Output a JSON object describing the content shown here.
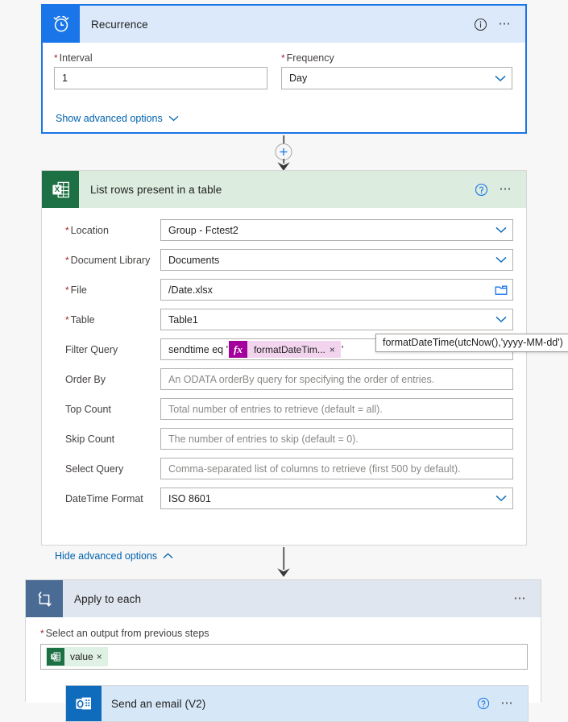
{
  "colors": {
    "recurrence_icon_bg": "#1a76e8",
    "recurrence_header_bg": "#dbe9fb",
    "recurrence_border": "#1a76e8",
    "excel_icon_bg": "#1d7044",
    "excel_header_bg": "#dcecdf",
    "loop_icon_bg": "#4a6c94",
    "loop_header_bg": "#dfe6ef",
    "outlook_icon_bg": "#0f6cbd",
    "outlook_header_bg": "#d6e7f7",
    "link_blue": "#0062ad",
    "required_red": "#a4262c",
    "token_magenta": "#a4009b"
  },
  "cards": {
    "recurrence": {
      "title": "Recurrence",
      "icon": "alarm-clock-icon",
      "info_icon": "info-icon",
      "more_icon": "more-options-icon",
      "fields": {
        "interval": {
          "label": "Interval",
          "required": true,
          "value": "1"
        },
        "frequency": {
          "label": "Frequency",
          "required": true,
          "value": "Day",
          "chevron": "chevron-down-icon"
        }
      },
      "advanced_link": "Show advanced options",
      "advanced_chevron": "chevron-down-icon"
    },
    "list_rows": {
      "title": "List rows present in a table",
      "icon": "excel-icon",
      "help_icon": "help-icon",
      "more_icon": "more-options-icon",
      "fields": [
        {
          "label": "Location",
          "required": true,
          "value": "Group - Fctest2",
          "type": "dropdown",
          "placeholder": false
        },
        {
          "label": "Document Library",
          "required": true,
          "value": "Documents",
          "type": "dropdown",
          "placeholder": false
        },
        {
          "label": "File",
          "required": true,
          "value": "/Date.xlsx",
          "type": "folder",
          "placeholder": false
        },
        {
          "label": "Table",
          "required": true,
          "value": "Table1",
          "type": "dropdown",
          "placeholder": false
        },
        {
          "label": "Filter Query",
          "required": false,
          "value": "",
          "type": "token",
          "placeholder": false
        },
        {
          "label": "Order By",
          "required": false,
          "value": "An ODATA orderBy query for specifying the order of entries.",
          "type": "text",
          "placeholder": true
        },
        {
          "label": "Top Count",
          "required": false,
          "value": "Total number of entries to retrieve (default = all).",
          "type": "text",
          "placeholder": true
        },
        {
          "label": "Skip Count",
          "required": false,
          "value": "The number of entries to skip (default = 0).",
          "type": "text",
          "placeholder": true
        },
        {
          "label": "Select Query",
          "required": false,
          "value": "Comma-separated list of columns to retrieve (first 500 by default).",
          "type": "text",
          "placeholder": true
        },
        {
          "label": "DateTime Format",
          "required": false,
          "value": "ISO 8601",
          "type": "dropdown",
          "placeholder": false
        }
      ],
      "filter_query": {
        "prefix": "sendtime eq '",
        "token_label": "formatDateTim...",
        "token_fx": "fx",
        "token_close": "×",
        "suffix": "'"
      },
      "tooltip": "formatDateTime(utcNow(),'yyyy-MM-dd')",
      "advanced_link": "Hide advanced options",
      "advanced_chevron": "chevron-up-icon"
    },
    "apply_to_each": {
      "title": "Apply to each",
      "icon": "loop-icon",
      "more_icon": "more-options-icon",
      "output_label": "Select an output from previous steps",
      "output_required": true,
      "token": {
        "label": "value",
        "icon": "excel-icon",
        "close": "×"
      }
    },
    "send_email": {
      "title": "Send an email (V2)",
      "icon": "outlook-icon",
      "help_icon": "help-icon",
      "more_icon": "more-options-icon"
    }
  },
  "connectors": [
    {
      "name": "connector-recurrence-to-listrows",
      "has_plus": true,
      "plus_icon": "plus-icon"
    },
    {
      "name": "connector-listrows-to-applytoeach",
      "has_plus": false
    }
  ]
}
